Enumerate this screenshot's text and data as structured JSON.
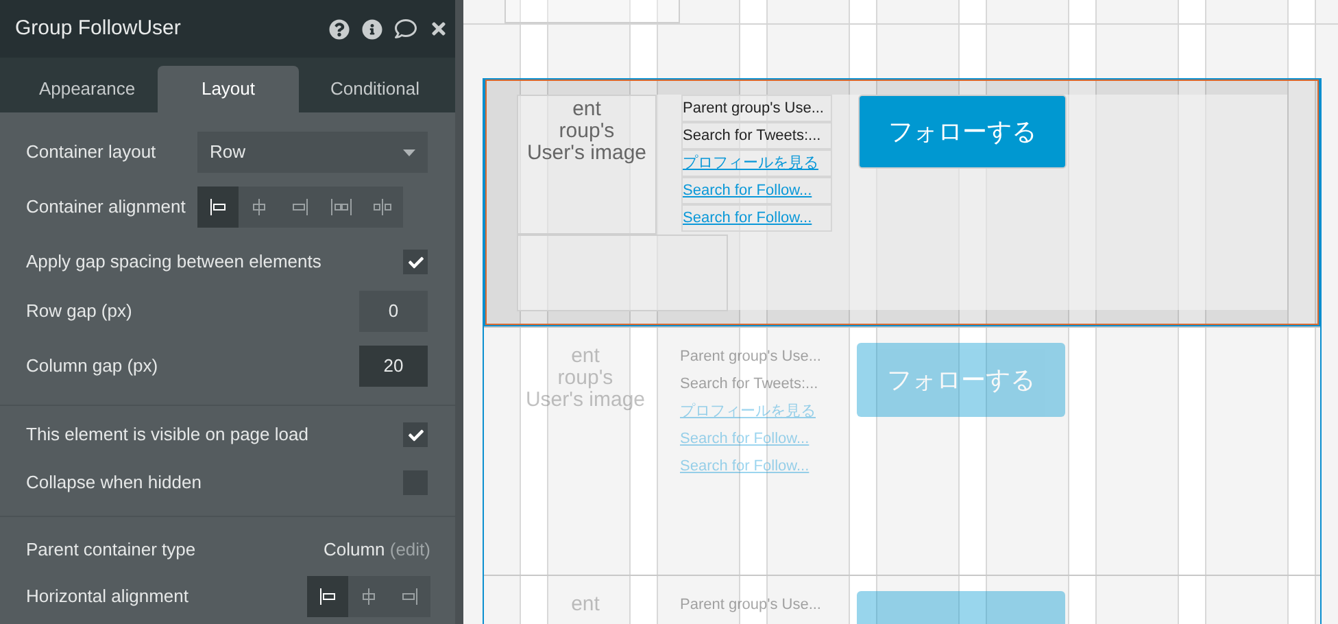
{
  "panel": {
    "title": "Group FollowUser",
    "tabs": [
      {
        "label": "Appearance",
        "selected": false
      },
      {
        "label": "Layout",
        "selected": true
      },
      {
        "label": "Conditional",
        "selected": false
      }
    ],
    "container_layout": {
      "label": "Container layout",
      "value": "Row"
    },
    "container_alignment": {
      "label": "Container alignment",
      "options": [
        {
          "kind": "left",
          "selected": true
        },
        {
          "kind": "center",
          "selected": false
        },
        {
          "kind": "right",
          "selected": false
        },
        {
          "kind": "between",
          "selected": false
        },
        {
          "kind": "around",
          "selected": false
        }
      ]
    },
    "gap_spacing": {
      "label": "Apply gap spacing between elements",
      "checked": true
    },
    "row_gap": {
      "label": "Row gap (px)",
      "value": "0",
      "focused": false
    },
    "column_gap": {
      "label": "Column gap (px)",
      "value": "20",
      "focused": true
    },
    "visible_on_load": {
      "label": "This element is visible on page load",
      "checked": true
    },
    "collapse_when_hidden": {
      "label": "Collapse when hidden",
      "checked": false
    },
    "parent_container_type": {
      "label": "Parent container type",
      "value": "Column",
      "link": "(edit)"
    },
    "horizontal_alignment": {
      "label": "Horizontal alignment",
      "options": [
        {
          "kind": "left",
          "selected": true
        },
        {
          "kind": "center",
          "selected": false
        },
        {
          "kind": "right",
          "selected": false
        }
      ]
    }
  },
  "canvas": {
    "cells": [
      {
        "selected": true,
        "image_text": [
          "ent",
          "roup's",
          "User's image"
        ],
        "texts": [
          {
            "kind": "text",
            "text": "Parent group's Use..."
          },
          {
            "kind": "text",
            "text": "Search for Tweets:..."
          },
          {
            "kind": "link",
            "text": "プロフィールを見る"
          },
          {
            "kind": "link",
            "text": "Search for Follow..."
          },
          {
            "kind": "link",
            "text": "Search for Follow..."
          }
        ],
        "button_label": "フォローする"
      },
      {
        "selected": false,
        "image_text": [
          "ent",
          "roup's",
          "User's image"
        ],
        "texts": [
          {
            "kind": "text",
            "text": "Parent group's Use..."
          },
          {
            "kind": "text",
            "text": "Search for Tweets:..."
          },
          {
            "kind": "link",
            "text": "プロフィールを見る"
          },
          {
            "kind": "link",
            "text": "Search for Follow..."
          },
          {
            "kind": "link",
            "text": "Search for Follow..."
          }
        ],
        "button_label": "フォローする"
      },
      {
        "selected": false,
        "image_text": [
          "ent"
        ],
        "texts": [
          {
            "kind": "text",
            "text": "Parent group's Use..."
          }
        ]
      }
    ]
  }
}
